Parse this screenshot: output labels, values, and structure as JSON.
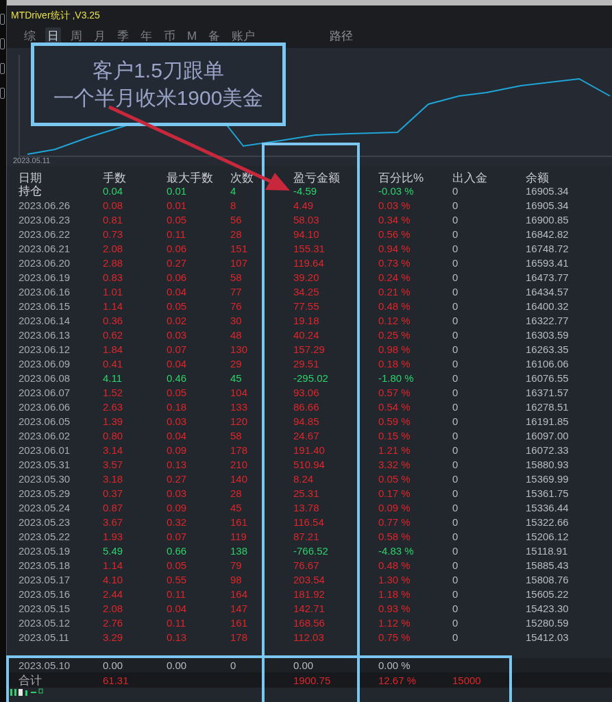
{
  "window": {
    "title": "MTDriver统计 ,V3.25"
  },
  "tabs": [
    {
      "label": "综",
      "selected": false
    },
    {
      "label": "日",
      "selected": true
    },
    {
      "label": "周",
      "selected": false
    },
    {
      "label": "月",
      "selected": false
    },
    {
      "label": "季",
      "selected": false
    },
    {
      "label": "年",
      "selected": false
    },
    {
      "label": "币",
      "selected": false
    },
    {
      "label": "M",
      "selected": false
    },
    {
      "label": "备",
      "selected": false
    },
    {
      "label": "账户",
      "selected": false
    }
  ],
  "path_label": "路径",
  "chart": {
    "start_label": "2023.05.11"
  },
  "table": {
    "columns": [
      "日期",
      "手数",
      "最大手数",
      "次数",
      "盈亏金额",
      "百分比%",
      "出入金",
      "余额"
    ],
    "rows": [
      {
        "kind": "loss",
        "cells": [
          "持仓",
          "0.04",
          "0.01",
          "4",
          "-4.59",
          "-0.03 %",
          "0",
          "16905.34"
        ]
      },
      {
        "kind": "gain",
        "cells": [
          "2023.06.26",
          "0.08",
          "0.01",
          "8",
          "4.49",
          "0.03 %",
          "0",
          "16905.34"
        ]
      },
      {
        "kind": "gain",
        "cells": [
          "2023.06.23",
          "0.81",
          "0.05",
          "56",
          "58.03",
          "0.34 %",
          "0",
          "16900.85"
        ]
      },
      {
        "kind": "gain",
        "cells": [
          "2023.06.22",
          "0.73",
          "0.11",
          "28",
          "94.10",
          "0.56 %",
          "0",
          "16842.82"
        ]
      },
      {
        "kind": "gain",
        "cells": [
          "2023.06.21",
          "2.08",
          "0.06",
          "151",
          "155.31",
          "0.94 %",
          "0",
          "16748.72"
        ]
      },
      {
        "kind": "gain",
        "cells": [
          "2023.06.20",
          "2.88",
          "0.27",
          "107",
          "119.64",
          "0.73 %",
          "0",
          "16593.41"
        ]
      },
      {
        "kind": "gain",
        "cells": [
          "2023.06.19",
          "0.83",
          "0.06",
          "58",
          "39.20",
          "0.24 %",
          "0",
          "16473.77"
        ]
      },
      {
        "kind": "gain",
        "cells": [
          "2023.06.16",
          "1.01",
          "0.04",
          "77",
          "34.25",
          "0.21 %",
          "0",
          "16434.57"
        ]
      },
      {
        "kind": "gain",
        "cells": [
          "2023.06.15",
          "1.14",
          "0.05",
          "76",
          "77.55",
          "0.48 %",
          "0",
          "16400.32"
        ]
      },
      {
        "kind": "gain",
        "cells": [
          "2023.06.14",
          "0.36",
          "0.02",
          "30",
          "19.18",
          "0.12 %",
          "0",
          "16322.77"
        ]
      },
      {
        "kind": "gain",
        "cells": [
          "2023.06.13",
          "0.62",
          "0.03",
          "48",
          "40.24",
          "0.25 %",
          "0",
          "16303.59"
        ]
      },
      {
        "kind": "gain",
        "cells": [
          "2023.06.12",
          "1.84",
          "0.07",
          "130",
          "157.29",
          "0.98 %",
          "0",
          "16263.35"
        ]
      },
      {
        "kind": "gain",
        "cells": [
          "2023.06.09",
          "0.41",
          "0.04",
          "29",
          "29.51",
          "0.18 %",
          "0",
          "16106.06"
        ]
      },
      {
        "kind": "loss",
        "cells": [
          "2023.06.08",
          "4.11",
          "0.46",
          "45",
          "-295.02",
          "-1.80 %",
          "0",
          "16076.55"
        ]
      },
      {
        "kind": "gain",
        "cells": [
          "2023.06.07",
          "1.52",
          "0.05",
          "104",
          "93.06",
          "0.57 %",
          "0",
          "16371.57"
        ]
      },
      {
        "kind": "gain",
        "cells": [
          "2023.06.06",
          "2.63",
          "0.18",
          "133",
          "86.66",
          "0.54 %",
          "0",
          "16278.51"
        ]
      },
      {
        "kind": "gain",
        "cells": [
          "2023.06.05",
          "1.39",
          "0.03",
          "120",
          "94.85",
          "0.59 %",
          "0",
          "16191.85"
        ]
      },
      {
        "kind": "gain",
        "cells": [
          "2023.06.02",
          "0.80",
          "0.04",
          "58",
          "24.67",
          "0.15 %",
          "0",
          "16097.00"
        ]
      },
      {
        "kind": "gain",
        "cells": [
          "2023.06.01",
          "3.14",
          "0.09",
          "178",
          "191.40",
          "1.21 %",
          "0",
          "16072.33"
        ]
      },
      {
        "kind": "gain",
        "cells": [
          "2023.05.31",
          "3.57",
          "0.13",
          "210",
          "510.94",
          "3.32 %",
          "0",
          "15880.93"
        ]
      },
      {
        "kind": "gain",
        "cells": [
          "2023.05.30",
          "3.18",
          "0.27",
          "140",
          "8.24",
          "0.05 %",
          "0",
          "15369.99"
        ]
      },
      {
        "kind": "gain",
        "cells": [
          "2023.05.29",
          "0.37",
          "0.03",
          "28",
          "25.31",
          "0.17 %",
          "0",
          "15361.75"
        ]
      },
      {
        "kind": "gain",
        "cells": [
          "2023.05.24",
          "0.87",
          "0.09",
          "45",
          "13.78",
          "0.09 %",
          "0",
          "15336.44"
        ]
      },
      {
        "kind": "gain",
        "cells": [
          "2023.05.23",
          "3.67",
          "0.32",
          "161",
          "116.54",
          "0.77 %",
          "0",
          "15322.66"
        ]
      },
      {
        "kind": "gain",
        "cells": [
          "2023.05.22",
          "1.93",
          "0.07",
          "119",
          "87.21",
          "0.58 %",
          "0",
          "15206.12"
        ]
      },
      {
        "kind": "loss",
        "cells": [
          "2023.05.19",
          "5.49",
          "0.66",
          "138",
          "-766.52",
          "-4.83 %",
          "0",
          "15118.91"
        ]
      },
      {
        "kind": "gain",
        "cells": [
          "2023.05.18",
          "1.14",
          "0.05",
          "79",
          "76.67",
          "0.48 %",
          "0",
          "15885.43"
        ]
      },
      {
        "kind": "gain",
        "cells": [
          "2023.05.17",
          "4.10",
          "0.55",
          "98",
          "203.54",
          "1.30 %",
          "0",
          "15808.76"
        ]
      },
      {
        "kind": "gain",
        "cells": [
          "2023.05.16",
          "2.44",
          "0.11",
          "164",
          "181.92",
          "1.18 %",
          "0",
          "15605.22"
        ]
      },
      {
        "kind": "gain",
        "cells": [
          "2023.05.15",
          "2.08",
          "0.04",
          "147",
          "142.71",
          "0.93 %",
          "0",
          "15423.30"
        ]
      },
      {
        "kind": "gain",
        "cells": [
          "2023.05.12",
          "2.76",
          "0.11",
          "161",
          "168.56",
          "1.12 %",
          "0",
          "15280.59"
        ]
      },
      {
        "kind": "gain",
        "cells": [
          "2023.05.11",
          "3.29",
          "0.13",
          "178",
          "112.03",
          "0.75 %",
          "0",
          "15412.03"
        ]
      },
      {
        "kind": "flat",
        "cells": [
          "2023.05.10",
          "0.00",
          "0.00",
          "0",
          "0.00",
          "0.00 %"
        ]
      }
    ],
    "total": {
      "cells": [
        "合计",
        "61.31",
        "",
        "",
        "1900.75",
        "12.67 %",
        "15000"
      ]
    }
  },
  "callout": {
    "lines": [
      "客户1.5刀跟单",
      "一个半月收米1900美金"
    ]
  }
}
